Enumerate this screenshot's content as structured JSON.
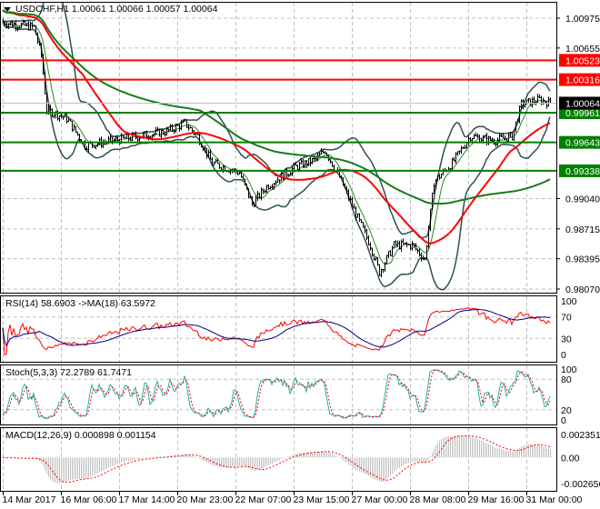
{
  "header": {
    "symbol": "USDCHF,H1",
    "open": "1.00061",
    "high": "1.00066",
    "low": "1.00057",
    "close": "1.00064"
  },
  "colors": {
    "bull": "#000000",
    "resistance": "#ff0000",
    "support": "#008000",
    "ma_fast": "#ff0000",
    "ma_slow": "#1a7a1a",
    "bands": "#2f4f4f",
    "rsi": "#ff0000",
    "rsi_ma": "#000080",
    "stoch_main": "#20b2aa",
    "stoch_signal": "#ff0000",
    "macd_hist": "#c0c0c0",
    "macd_signal": "#ff0000"
  },
  "chart_data": {
    "type": "line",
    "title": "USDCHF,H1",
    "price_axis": {
      "ticks": [
        "1.00975",
        "1.00655",
        "0.99040",
        "0.98715",
        "0.98395",
        "0.98070"
      ],
      "range": [
        0.9807,
        1.00975
      ]
    },
    "levels": [
      {
        "label": "1.00523",
        "value": 1.00523,
        "kind": "resistance"
      },
      {
        "label": "1.00316",
        "value": 1.00316,
        "kind": "resistance"
      },
      {
        "label": "0.99961",
        "value": 0.99961,
        "kind": "support"
      },
      {
        "label": "0.99643",
        "value": 0.99643,
        "kind": "support"
      },
      {
        "label": "0.99338",
        "value": 0.99338,
        "kind": "support"
      }
    ],
    "current_price": {
      "label": "1.00064",
      "value": 1.00064
    },
    "close_waypoints": [
      [
        0,
        1.0093
      ],
      [
        17,
        1.0088
      ],
      [
        21,
        1.0058
      ],
      [
        24,
        0.9999
      ],
      [
        35,
        0.999
      ],
      [
        45,
        0.9961
      ],
      [
        60,
        0.9966
      ],
      [
        75,
        0.9971
      ],
      [
        90,
        0.9976
      ],
      [
        100,
        0.9985
      ],
      [
        107,
        0.9971
      ],
      [
        115,
        0.9942
      ],
      [
        130,
        0.9932
      ],
      [
        137,
        0.9898
      ],
      [
        145,
        0.9917
      ],
      [
        160,
        0.9937
      ],
      [
        172,
        0.9946
      ],
      [
        177,
        0.9956
      ],
      [
        185,
        0.9927
      ],
      [
        195,
        0.9883
      ],
      [
        202,
        0.9854
      ],
      [
        207,
        0.9825
      ],
      [
        215,
        0.9854
      ],
      [
        225,
        0.9854
      ],
      [
        232,
        0.9839
      ],
      [
        237,
        0.9922
      ],
      [
        247,
        0.9942
      ],
      [
        257,
        0.9971
      ],
      [
        270,
        0.9966
      ],
      [
        280,
        0.9971
      ],
      [
        285,
        1.0005
      ],
      [
        295,
        1.001
      ],
      [
        301,
        1.00064
      ]
    ],
    "time_axis": {
      "ticks": [
        "14 Mar 2017",
        "16 Mar 06:00",
        "17 Mar 14:00",
        "20 Mar 23:00",
        "22 Mar 07:00",
        "23 Mar 15:00",
        "27 Mar 00:00",
        "28 Mar 08:00",
        "29 Mar 16:00",
        "31 Mar 00:00"
      ],
      "bars_per_tick": 32
    },
    "indicators": {
      "rsi": {
        "label": "RSI(14) 58.6903  ->MA(18) 63.5972",
        "ticks": [
          "100",
          "70",
          "30",
          "0"
        ],
        "range": [
          0,
          100
        ]
      },
      "stoch": {
        "label": "Stoch(5,3,3) 72.2789 61.7471",
        "ticks": [
          "100",
          "80",
          "20",
          "0"
        ],
        "range": [
          0,
          100
        ]
      },
      "macd": {
        "label": "MACD(12,26,9) 0.000898 0.001154",
        "ticks": [
          "0.002351",
          "0.00",
          "-0.002656"
        ],
        "range": [
          -0.002656,
          0.002351
        ]
      }
    }
  }
}
